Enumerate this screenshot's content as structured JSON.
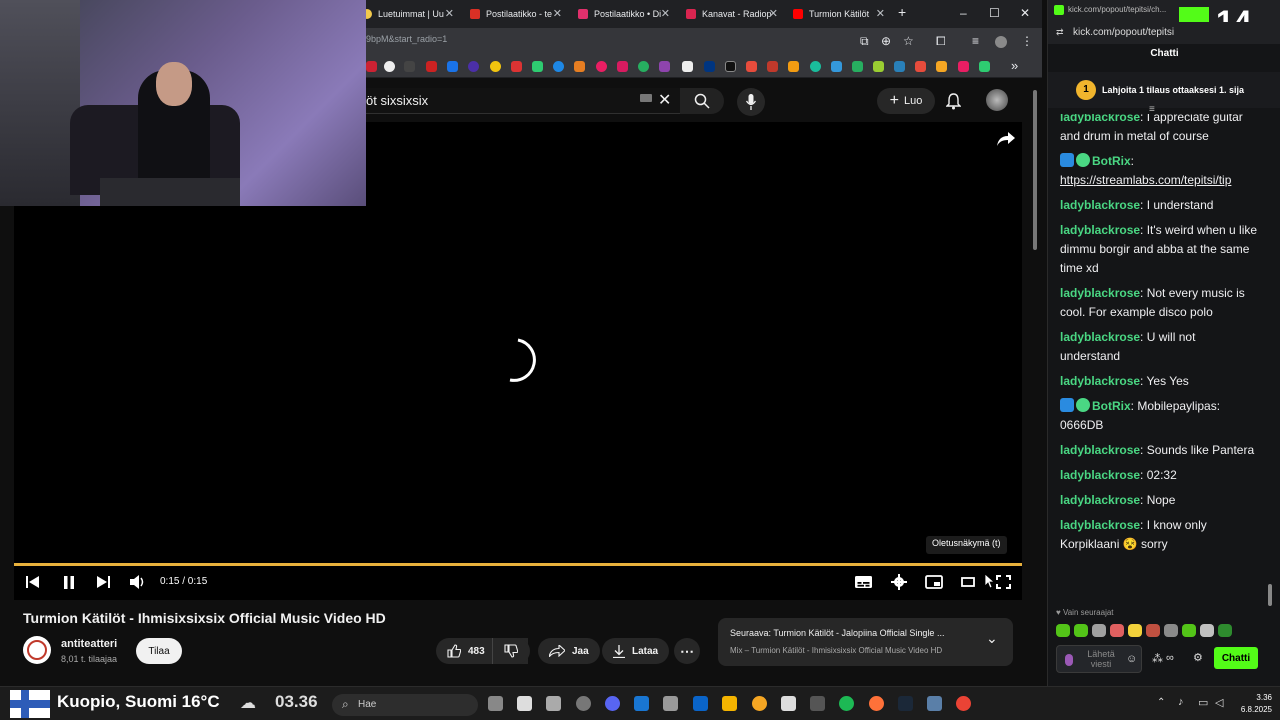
{
  "browser": {
    "tabs": [
      {
        "label": "Luetuimmat | Uu",
        "color": "#f2c94c"
      },
      {
        "label": "Postilaatikko - te",
        "color": "#d93025"
      },
      {
        "label": "Postilaatikko • Di",
        "color": "#e1306c"
      },
      {
        "label": "Kanavat - Radiop",
        "color": "#d92550"
      },
      {
        "label": "Turmion Kätilöt",
        "color": "#ff0000"
      }
    ],
    "new_tab": "+",
    "url_fragment": "9bpM&start_radio=1",
    "controls": {
      "minimize": "–",
      "maximize": "☐",
      "close": "✕"
    }
  },
  "youtube": {
    "search_value": "öt sixsixsix",
    "create_label": "Luo",
    "player": {
      "time": "0:15 / 0:15",
      "progress": 1.0,
      "tooltip": "Oletusnäkymä (t)"
    },
    "video_title": "Turmion Kätilöt - Ihmisixsixsix Official Music Video HD",
    "channel": {
      "name": "antiteatteri",
      "subscribers": "8,01 t. tilaajaa"
    },
    "subscribe_label": "Tilaa",
    "likes": "483",
    "share_label": "Jaa",
    "download_label": "Lataa",
    "next": {
      "line1": "Seuraava: Turmion Kätilöt - Jalopiina Official Single ...",
      "line2": "Mix – Turmion Kätilöt - Ihmisixsixsix Official Music Video HD"
    }
  },
  "chat": {
    "url": "kick.com/popout/tepitsi/ch...",
    "url2": "kick.com/popout/tepitsi",
    "viewer_count": "14",
    "heading": "Chatti",
    "pinned": {
      "rank": "1",
      "text": "Lahjoita 1 tilaus ottaaksesi 1. sija"
    },
    "messages": [
      {
        "user": "ladyblackrose",
        "text": "I appreciate guitar and drum in metal of course",
        "bot": false
      },
      {
        "user": "BotRix",
        "text": "https://streamlabs.com/tepitsi/tip",
        "bot": true
      },
      {
        "user": "ladyblackrose",
        "text": "I understand",
        "bot": false
      },
      {
        "user": "ladyblackrose",
        "text": "It's weird when u like dimmu borgir and abba at the same time xd",
        "bot": false
      },
      {
        "user": "ladyblackrose",
        "text": "Not every music is cool. For example disco polo",
        "bot": false
      },
      {
        "user": "ladyblackrose",
        "text": "U will not understand",
        "bot": false
      },
      {
        "user": "ladyblackrose",
        "text": "Yes Yes",
        "bot": false
      },
      {
        "user": "BotRix",
        "text": "Mobilepaylipas: 0666DB",
        "bot": true
      },
      {
        "user": "ladyblackrose",
        "text": "Sounds like Pantera",
        "bot": false
      },
      {
        "user": "ladyblackrose",
        "text": "02:32",
        "bot": false
      },
      {
        "user": "ladyblackrose",
        "text": "Nope",
        "bot": false
      },
      {
        "user": "ladyblackrose",
        "text": "I know only Korpiklaani 😵 sorry",
        "bot": false
      }
    ],
    "followers_only": "♥ Vain seuraajat",
    "input_placeholder": "Lähetä viesti",
    "send_label": "Chatti"
  },
  "taskbar": {
    "weather": "Kuopio, Suomi 16°C",
    "time_overlay": "03.36",
    "search_label": "Hae",
    "clock_time": "3.36",
    "clock_date": "6.8.2025"
  }
}
